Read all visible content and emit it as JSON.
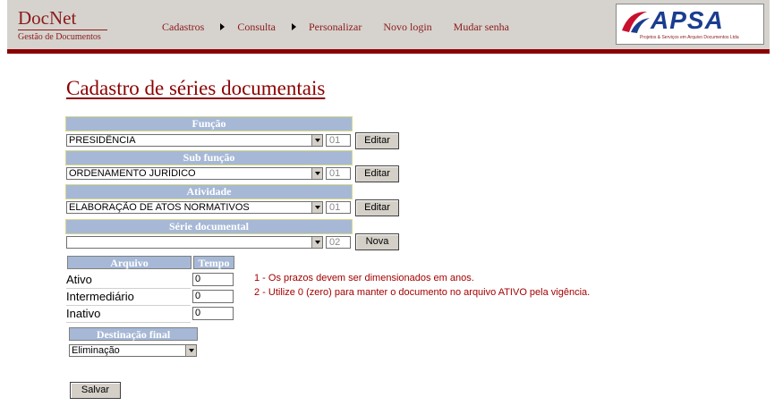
{
  "header": {
    "app_title": "DocNet",
    "app_subtitle": "Gestão de Documentos",
    "nav": [
      "Cadastros",
      "Consulta",
      "Personalizar",
      "Novo login",
      "Mudar senha"
    ],
    "brand_name": "APSA",
    "brand_tagline": "Projetos & Serviços em Arquivo Documentos Ltda",
    "colors": {
      "header_bg": "#d6d3ce",
      "accent": "#8b0000",
      "section_bg": "#a6b8d6",
      "note": "#a40000"
    }
  },
  "page": {
    "title": "Cadastro de séries documentais"
  },
  "funcao": {
    "label": "Função",
    "selected": "PRESIDÊNCIA",
    "code": "01",
    "button": "Editar"
  },
  "subfuncao": {
    "label": "Sub função",
    "selected": "ORDENAMENTO JURÍDICO",
    "code": "01",
    "button": "Editar"
  },
  "atividade": {
    "label": "Atividade",
    "selected": "ELABORAÇÃO DE ATOS NORMATIVOS",
    "code": "01",
    "button": "Editar"
  },
  "serie": {
    "label": "Série documental",
    "selected": "",
    "code": "02",
    "button": "Nova"
  },
  "arquivo": {
    "col_arquivo": "Arquivo",
    "col_tempo": "Tempo",
    "rows": [
      {
        "label": "Ativo",
        "value": "0"
      },
      {
        "label": "Intermediário",
        "value": "0"
      },
      {
        "label": "Inativo",
        "value": "0"
      }
    ]
  },
  "notes": [
    "1 - Os prazos devem ser dimensionados em anos.",
    "2 - Utilize 0 (zero) para manter o documento no arquivo ATIVO pela vigência."
  ],
  "destinacao": {
    "label": "Destinação final",
    "selected": "Eliminação"
  },
  "save_button": "Salvar"
}
